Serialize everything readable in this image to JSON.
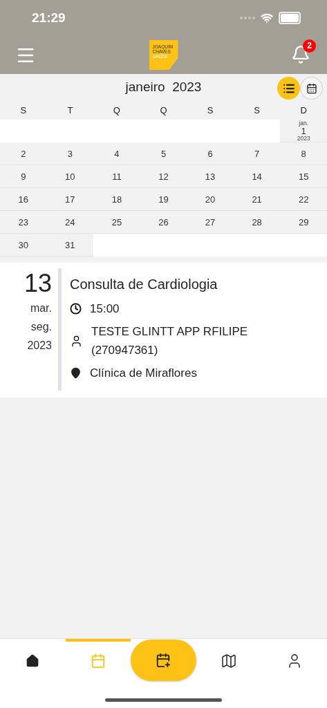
{
  "status_bar": {
    "time": "21:29"
  },
  "header": {
    "logo": [
      "JOAQUIM",
      "CHAVES",
      "SAÚDE"
    ],
    "notifications": "2"
  },
  "calendar": {
    "title": "janeiro  2023",
    "views": [
      {
        "kind": "list",
        "selected": true
      },
      {
        "kind": "month",
        "selected": false
      }
    ],
    "weekdays": [
      "S",
      "T",
      "Q",
      "Q",
      "S",
      "S",
      "D"
    ],
    "weeks": [
      [
        {
          "kind": "empty"
        },
        {
          "kind": "empty"
        },
        {
          "kind": "empty"
        },
        {
          "kind": "empty"
        },
        {
          "kind": "empty"
        },
        {
          "kind": "empty"
        },
        {
          "kind": "first",
          "month": "jan.",
          "day": "1",
          "year": "2023"
        }
      ],
      [
        {
          "kind": "day",
          "day": "2"
        },
        {
          "kind": "day",
          "day": "3"
        },
        {
          "kind": "day",
          "day": "4"
        },
        {
          "kind": "day",
          "day": "5"
        },
        {
          "kind": "day",
          "day": "6"
        },
        {
          "kind": "day",
          "day": "7"
        },
        {
          "kind": "day",
          "day": "8"
        }
      ],
      [
        {
          "kind": "day",
          "day": "9"
        },
        {
          "kind": "day",
          "day": "10"
        },
        {
          "kind": "day",
          "day": "11"
        },
        {
          "kind": "day",
          "day": "12"
        },
        {
          "kind": "day",
          "day": "13"
        },
        {
          "kind": "day",
          "day": "14"
        },
        {
          "kind": "day",
          "day": "15"
        }
      ],
      [
        {
          "kind": "day",
          "day": "16"
        },
        {
          "kind": "day",
          "day": "17"
        },
        {
          "kind": "day",
          "day": "18"
        },
        {
          "kind": "day",
          "day": "19"
        },
        {
          "kind": "day",
          "day": "20"
        },
        {
          "kind": "day",
          "day": "21"
        },
        {
          "kind": "day",
          "day": "22"
        }
      ],
      [
        {
          "kind": "day",
          "day": "23"
        },
        {
          "kind": "day",
          "day": "24"
        },
        {
          "kind": "day",
          "day": "25"
        },
        {
          "kind": "day",
          "day": "26"
        },
        {
          "kind": "day",
          "day": "27"
        },
        {
          "kind": "day",
          "day": "28"
        },
        {
          "kind": "day",
          "day": "29"
        }
      ],
      [
        {
          "kind": "day",
          "day": "30"
        },
        {
          "kind": "day",
          "day": "31"
        },
        {
          "kind": "empty"
        },
        {
          "kind": "empty"
        },
        {
          "kind": "empty"
        },
        {
          "kind": "empty"
        },
        {
          "kind": "empty"
        }
      ]
    ]
  },
  "appointments": [
    {
      "day": "13",
      "month": "mar.",
      "weekday": "seg.",
      "year": "2023",
      "title": "Consulta de Cardiologia",
      "time": "15:00",
      "patient": "TESTE GLINTT APP RFILIPE (270947361)",
      "location": "Clínica de Miraflores"
    }
  ],
  "nav": [
    {
      "kind": "home",
      "selected": false
    },
    {
      "kind": "calendar",
      "selected": true
    },
    {
      "kind": "add",
      "selected": false
    },
    {
      "kind": "map",
      "selected": false
    },
    {
      "kind": "profile",
      "selected": false
    }
  ]
}
